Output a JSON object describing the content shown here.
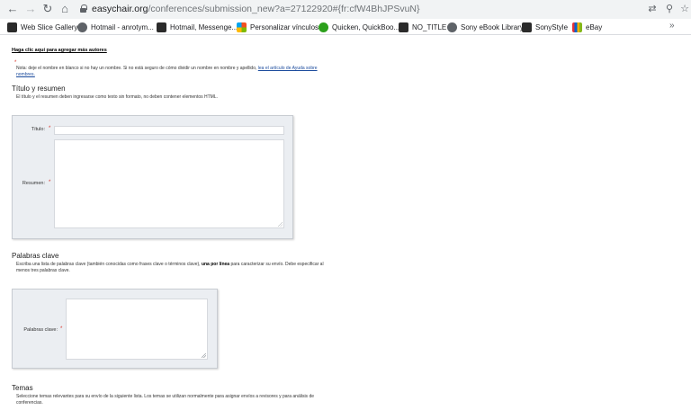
{
  "browser": {
    "url_host": "easychair.org",
    "url_path": "/conferences/submission_new?a=27122920#{fr:cfW4BhJPSvuN}",
    "bookmarks": [
      {
        "label": "Web Slice Gallery",
        "icon": "dark"
      },
      {
        "label": "Hotmail - anrotym...",
        "icon": "globe"
      },
      {
        "label": "Hotmail, Messenge...",
        "icon": "dark"
      },
      {
        "label": "Personalizar vínculos",
        "icon": "ms"
      },
      {
        "label": "Quicken, QuickBoo...",
        "icon": "green"
      },
      {
        "label": "NO_TITLE",
        "icon": "dark"
      },
      {
        "label": "Sony eBook Library",
        "icon": "globe"
      },
      {
        "label": "SonyStyle",
        "icon": "dark"
      },
      {
        "label": "eBay",
        "icon": "ebay"
      }
    ],
    "more_label": "»"
  },
  "authors": {
    "add_more_link": "Haga clic aquí para agregar más autores",
    "required_mark": "*",
    "note_text": "Nota: deje el nombre en blanco si no hay un nombre. Si no está seguro de cómo dividir un nombre en nombre y apellido, ",
    "note_link": "lea el artículo de Ayuda sobre nombres."
  },
  "title_section": {
    "heading": "Título y resumen",
    "description": "El título y el resumen deben ingresarse como texto sin formato, no deben contener elementos HTML.",
    "title_label": "Título:",
    "abstract_label": "Resumen:",
    "required_mark": "*",
    "title_value": "",
    "abstract_value": ""
  },
  "keywords_section": {
    "heading": "Palabras clave",
    "description_start": "Escriba una lista de palabras clave (también conocidas como frases clave o términos clave), ",
    "description_bold": "una por línea",
    "description_end": " para caracterizar su envío. Debe especificar al menos tres palabras clave.",
    "keywords_label": "Palabras clave:",
    "required_mark": "*",
    "keywords_value": ""
  },
  "topics_section": {
    "heading": "Temas",
    "description": "Seleccione temas relevantes para su envío de la siguiente lista. Los temas se utilizan normalmente para asignar envíos a revisores y para análisis de conferencias."
  }
}
